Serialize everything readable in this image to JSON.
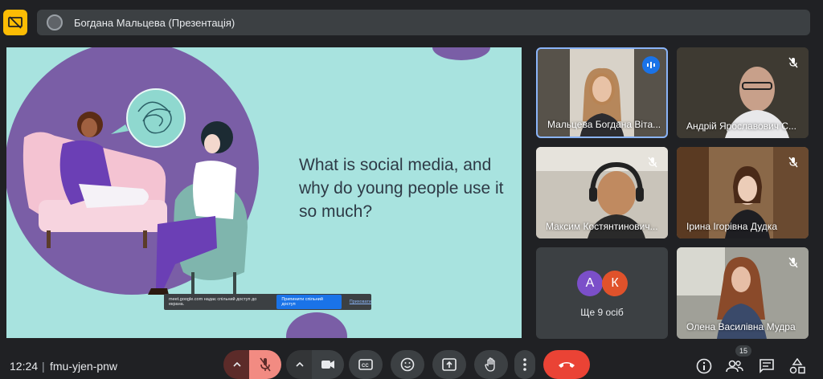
{
  "presentation": {
    "title": "Богдана Мальцева (Презентація)",
    "slide_title": "What is social media, and why do young people use it so much?",
    "share_prompt": "meet.google.com надає спільний доступ до екрана.",
    "share_stop": "Припинити спільний доступ",
    "share_hide": "Приховати"
  },
  "participants": [
    {
      "name": "Мальцева Богдана Віта..."
    },
    {
      "name": "Андрій Ярославович С..."
    },
    {
      "name": "Максим Костянтинович..."
    },
    {
      "name": "Ірина Ігорівна Дудка"
    },
    {
      "name": "Олена Василівна Мудра"
    }
  ],
  "others": {
    "label": "Ще 9 осіб",
    "avatars": [
      {
        "letter": "А",
        "color": "#7b4fc9"
      },
      {
        "letter": "К",
        "color": "#e0522b"
      }
    ]
  },
  "meeting": {
    "time": "12:24",
    "separator": "|",
    "code": "fmu-yjen-pnw",
    "participant_count": "15"
  },
  "colors": {
    "background": "#202124",
    "hangup": "#ea4335",
    "mic_off": "#f28b82",
    "accent": "#1a73e8",
    "slide_bg": "#a8e3df",
    "slide_purple": "#7a5ea6"
  }
}
